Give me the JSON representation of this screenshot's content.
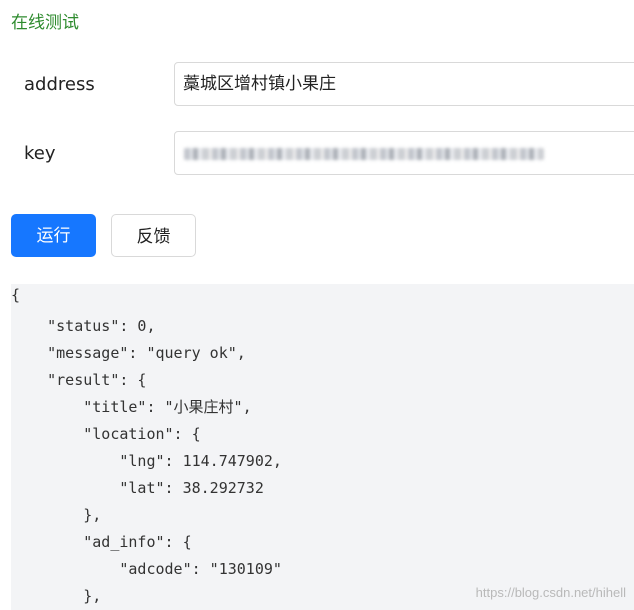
{
  "section": {
    "title": "在线测试"
  },
  "form": {
    "address": {
      "label": "address",
      "value": "藁城区增村镇小果庄"
    },
    "key": {
      "label": "key"
    }
  },
  "buttons": {
    "run_label": "运行",
    "feedback_label": "反馈"
  },
  "output": {
    "lines": [
      "{",
      "    \"status\": 0,",
      "    \"message\": \"query ok\",",
      "    \"result\": {",
      "        \"title\": \"小果庄村\",",
      "        \"location\": {",
      "            \"lng\": 114.747902,",
      "            \"lat\": 38.292732",
      "        },",
      "        \"ad_info\": {",
      "            \"adcode\": \"130109\"",
      "        },"
    ]
  },
  "watermark": "https://blog.csdn.net/hihell",
  "colors": {
    "section_title": "#2e8b2e",
    "primary_button": "#1677ff",
    "code_background": "#f3f4f6"
  }
}
